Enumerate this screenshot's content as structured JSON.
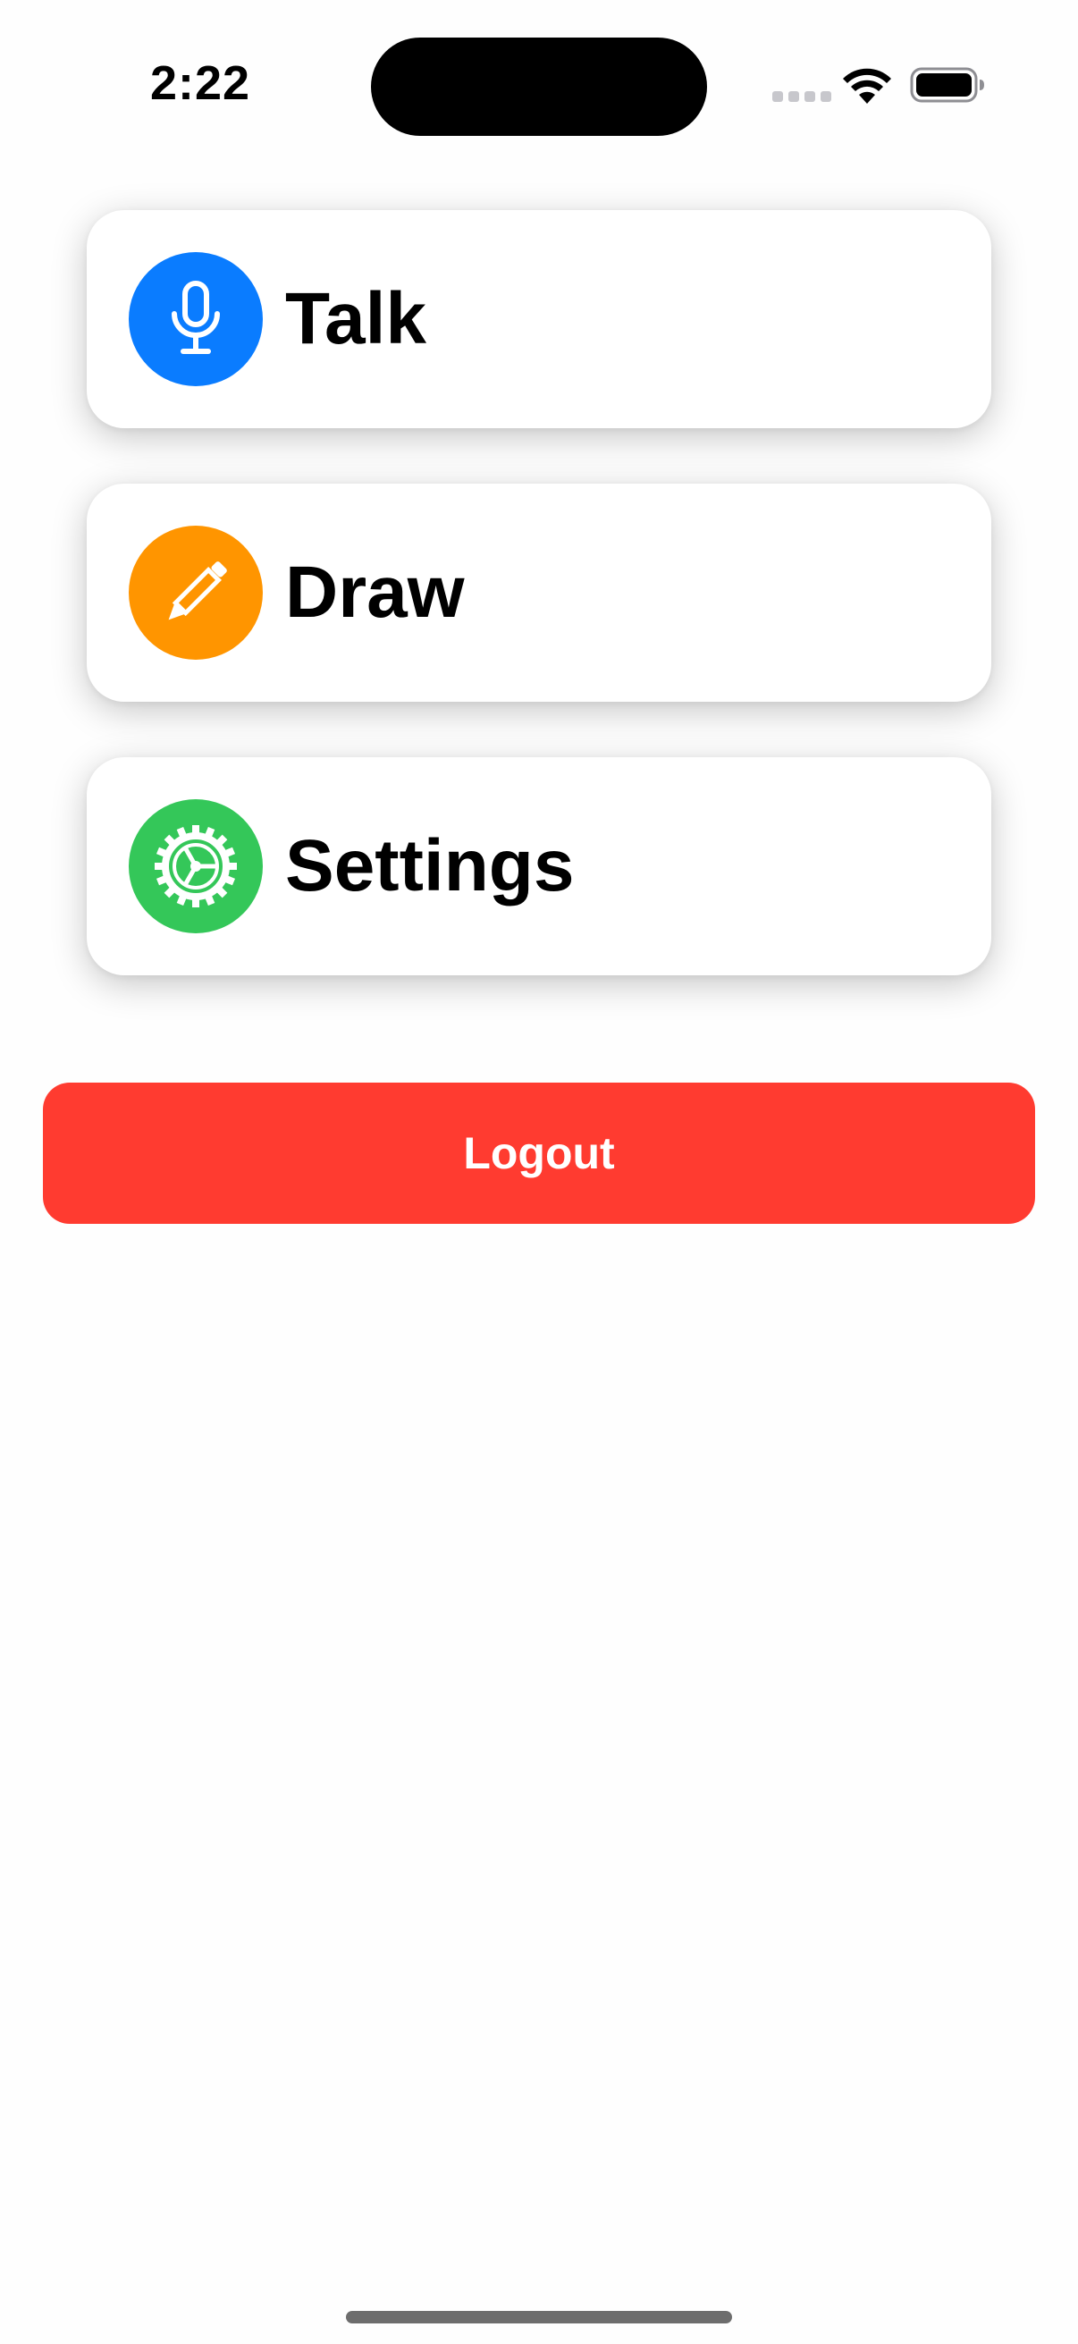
{
  "status_bar": {
    "time": "2:22"
  },
  "menu": {
    "items": [
      {
        "label": "Talk",
        "icon": "microphone-icon",
        "color": "#0a7cff"
      },
      {
        "label": "Draw",
        "icon": "pencil-icon",
        "color": "#ff9500"
      },
      {
        "label": "Settings",
        "icon": "gear-icon",
        "color": "#34c759"
      }
    ]
  },
  "logout": {
    "label": "Logout",
    "color": "#ff3b30"
  }
}
